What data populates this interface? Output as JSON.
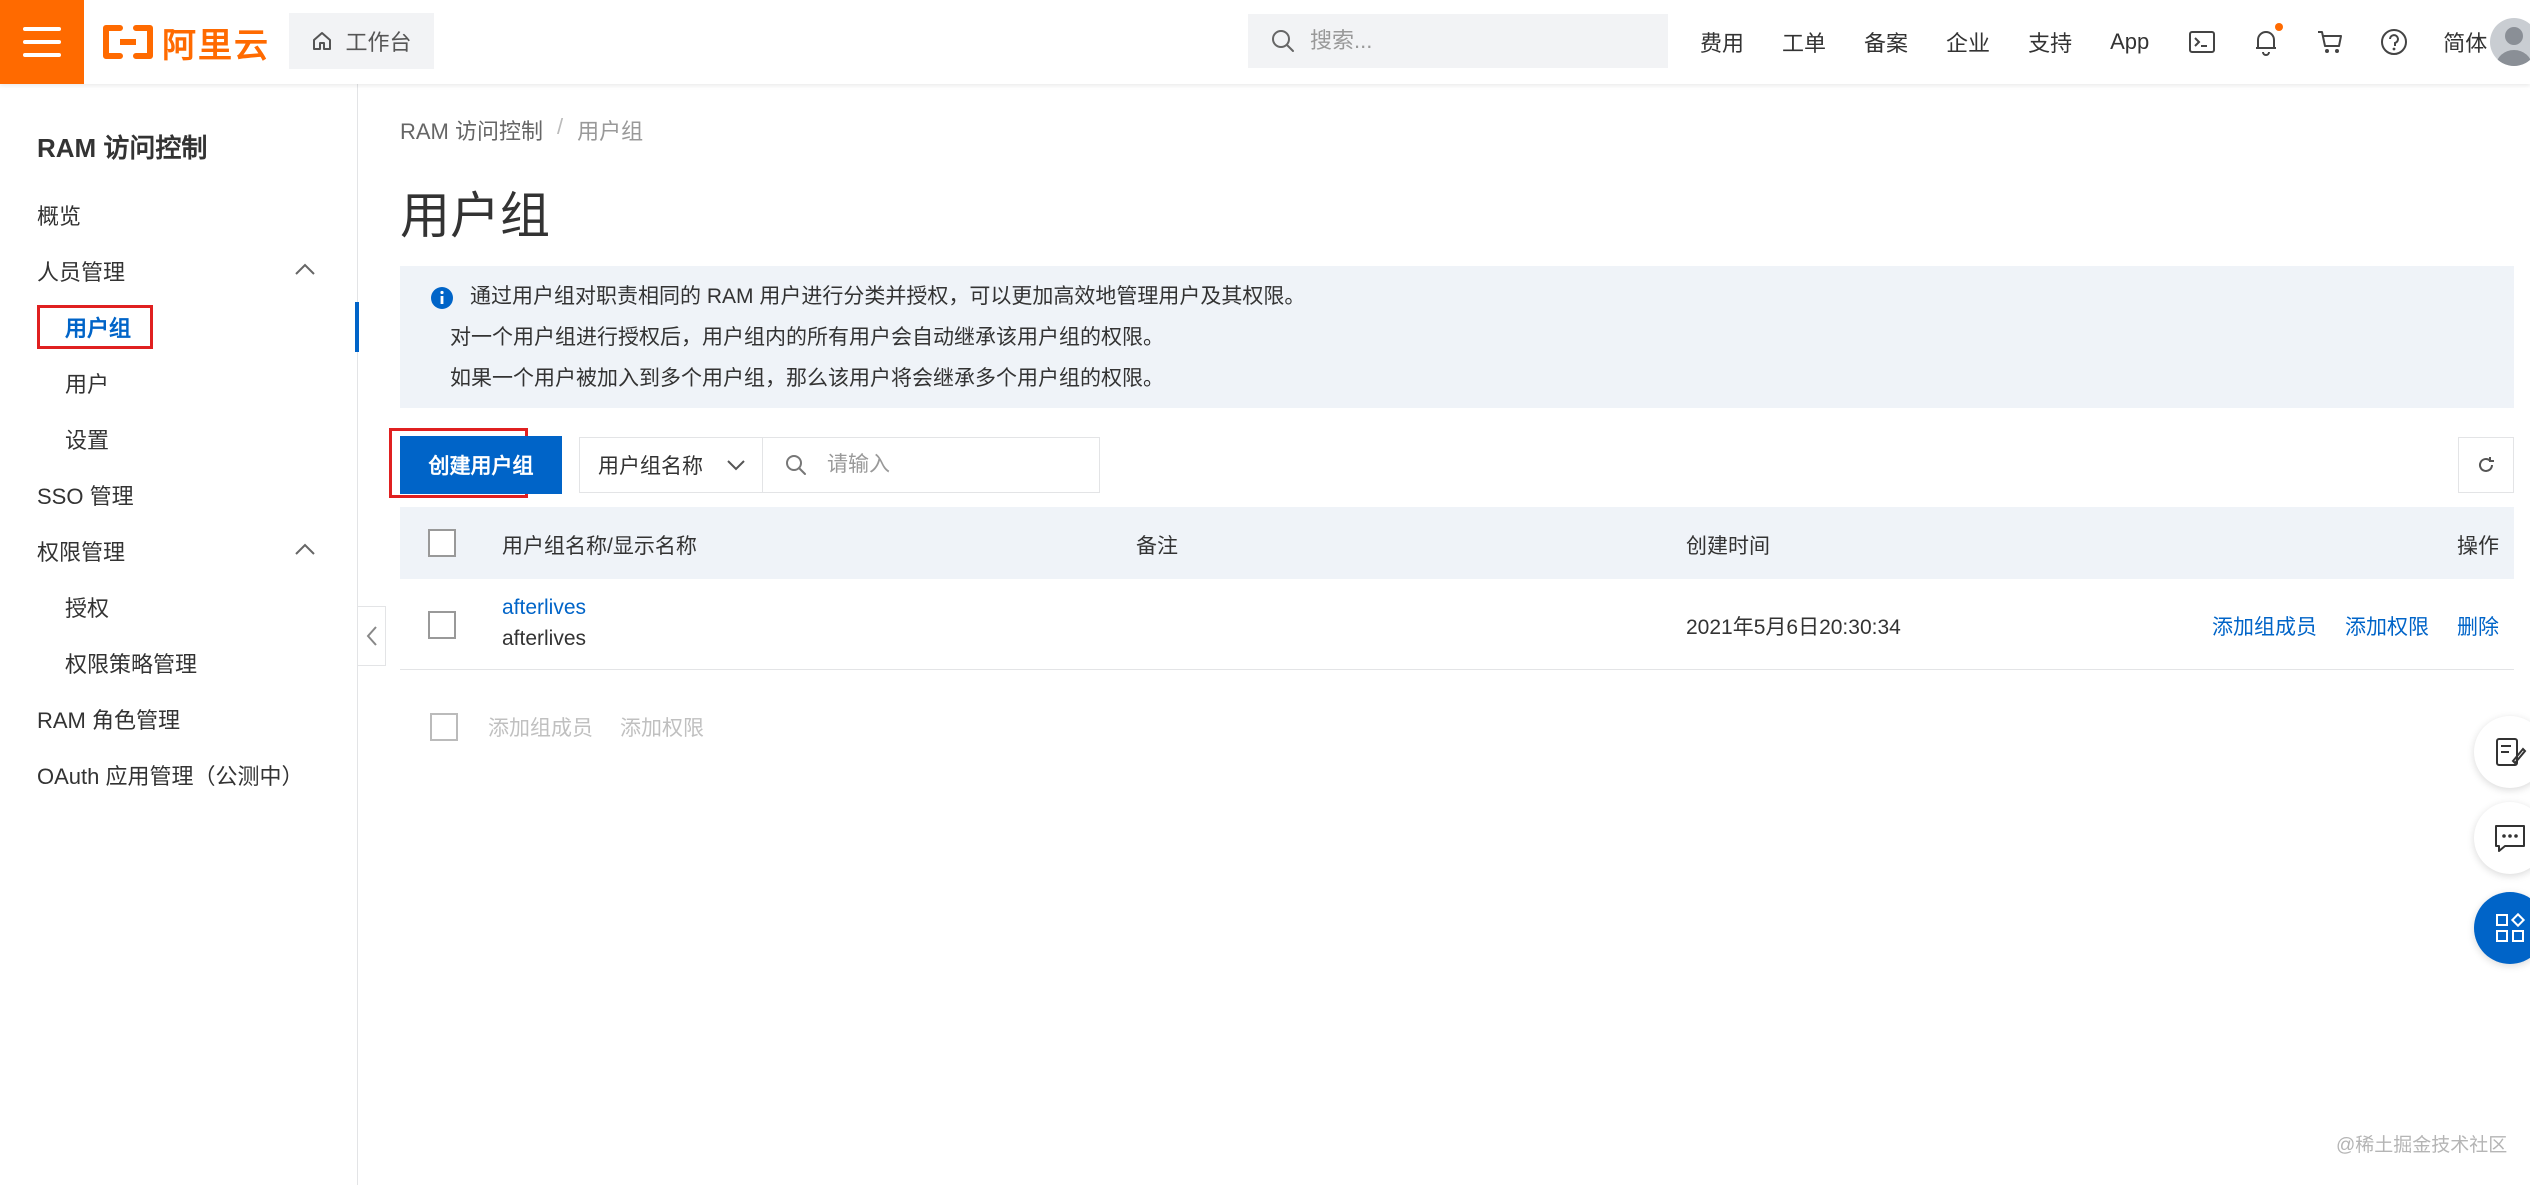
{
  "colors": {
    "brand": "#ff6a00",
    "accent": "#0064c8",
    "highlight": "#e02020",
    "info_bg": "#eff3f8"
  },
  "topbar": {
    "logo_text": "阿里云",
    "workbench_label": "工作台",
    "search_placeholder": "搜索...",
    "nav": [
      "费用",
      "工单",
      "备案",
      "企业",
      "支持",
      "App"
    ],
    "lang_label": "简体"
  },
  "sidebar": {
    "title": "RAM 访问控制",
    "items": [
      {
        "label": "概览",
        "level": 1
      },
      {
        "label": "人员管理",
        "level": 1,
        "expanded": true
      },
      {
        "label": "用户组",
        "level": 2,
        "active": true
      },
      {
        "label": "用户",
        "level": 2
      },
      {
        "label": "设置",
        "level": 2
      },
      {
        "label": "SSO 管理",
        "level": 1
      },
      {
        "label": "权限管理",
        "level": 1,
        "expanded": true
      },
      {
        "label": "授权",
        "level": 2
      },
      {
        "label": "权限策略管理",
        "level": 2
      },
      {
        "label": "RAM 角色管理",
        "level": 1
      },
      {
        "label": "OAuth 应用管理（公测中）",
        "level": 1
      }
    ]
  },
  "breadcrumb": {
    "root": "RAM 访问控制",
    "sep": "/",
    "current": "用户组"
  },
  "page_title": "用户组",
  "info": {
    "lines": [
      "通过用户组对职责相同的 RAM 用户进行分类并授权，可以更加高效地管理用户及其权限。",
      "对一个用户组进行授权后，用户组内的所有用户会自动继承该用户组的权限。",
      "如果一个用户被加入到多个用户组，那么该用户将会继承多个用户组的权限。"
    ]
  },
  "toolbar": {
    "create_label": "创建用户组",
    "filter_select_value": "用户组名称",
    "filter_placeholder": "请输入"
  },
  "table": {
    "headers": [
      "用户组名称/显示名称",
      "备注",
      "创建时间",
      "操作"
    ],
    "rows": [
      {
        "name": "afterlives",
        "display_name": "afterlives",
        "note": "",
        "created": "2021年5月6日20:30:34",
        "actions": [
          "添加组成员",
          "添加权限",
          "删除"
        ]
      }
    ]
  },
  "bulk_actions": [
    "添加组成员",
    "添加权限"
  ],
  "watermark": "@稀土掘金技术社区"
}
